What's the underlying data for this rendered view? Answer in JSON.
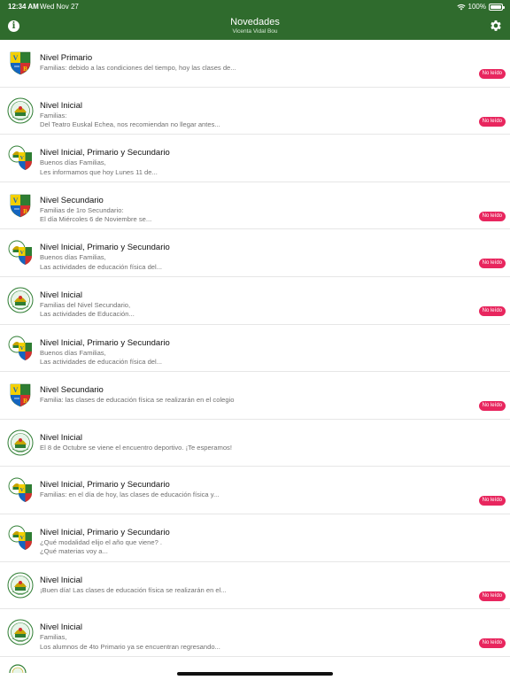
{
  "status_bar": {
    "time": "12:34 AM",
    "date": "Wed Nov 27",
    "battery": "100%",
    "battery_level": 1.0
  },
  "header": {
    "title": "Novedades",
    "subtitle": "Vicenta Vidal Bou",
    "info_icon": "info-icon",
    "settings_icon": "gear-icon"
  },
  "colors": {
    "header": "#2f6b2d",
    "badge": "#e8265e",
    "text_secondary": "#707070"
  },
  "badge_label": "No leído",
  "list": [
    {
      "logo": "shield",
      "title": "Nivel Primario",
      "lines": [
        "Familias: debido a las condiciones del tiempo, hoy las clases de..."
      ],
      "unread": true
    },
    {
      "logo": "seal",
      "title": "Nivel Inicial",
      "lines": [
        "Familias:",
        "Del Teatro Euskal Echea, nos recomiendan no llegar antes..."
      ],
      "unread": true
    },
    {
      "logo": "combo",
      "title": "Nivel Inicial, Primario y Secundario",
      "lines": [
        "Buenos días Familias,",
        "Les informamos que hoy Lunes 11 de..."
      ],
      "unread": false
    },
    {
      "logo": "shield",
      "title": "Nivel Secundario",
      "lines": [
        "Familias de 1ro Secundario:",
        "El día Miércoles 6 de Noviembre se..."
      ],
      "unread": true
    },
    {
      "logo": "combo",
      "title": "Nivel Inicial, Primario y Secundario",
      "lines": [
        "Buenos días Familias,",
        "Las actividades de educación física del..."
      ],
      "unread": true
    },
    {
      "logo": "seal",
      "title": "Nivel Inicial",
      "lines": [
        "Familias del Nivel Secundario,",
        "Las actividades de Educación..."
      ],
      "unread": true
    },
    {
      "logo": "combo",
      "title": "Nivel Inicial, Primario y Secundario",
      "lines": [
        "Buenos días Familias,",
        "Las actividades de educación física del..."
      ],
      "unread": false
    },
    {
      "logo": "shield",
      "title": "Nivel Secundario",
      "lines": [
        "Familia: las clases de educación física se realizarán en el colegio"
      ],
      "unread": true
    },
    {
      "logo": "seal",
      "title": "Nivel Inicial",
      "lines": [
        "El 8 de Octubre se viene el encuentro deportivo. ¡Te esperamos!"
      ],
      "unread": false
    },
    {
      "logo": "combo",
      "title": "Nivel Inicial, Primario y Secundario",
      "lines": [
        "Familias: en el día de hoy, las clases de educación física y..."
      ],
      "unread": true
    },
    {
      "logo": "combo",
      "title": "Nivel Inicial, Primario y Secundario",
      "lines": [
        "¿Qué modalidad elijo el año que viene? .",
        "¿Qué materias voy a..."
      ],
      "unread": false
    },
    {
      "logo": "seal",
      "title": "Nivel Inicial",
      "lines": [
        "¡Buen día! Las clases de educación física se realizarán en el..."
      ],
      "unread": true
    },
    {
      "logo": "seal",
      "title": "Nivel Inicial",
      "lines": [
        "Familias,",
        "Los alumnos de 4to Primario ya se encuentran regresando..."
      ],
      "unread": true
    }
  ]
}
